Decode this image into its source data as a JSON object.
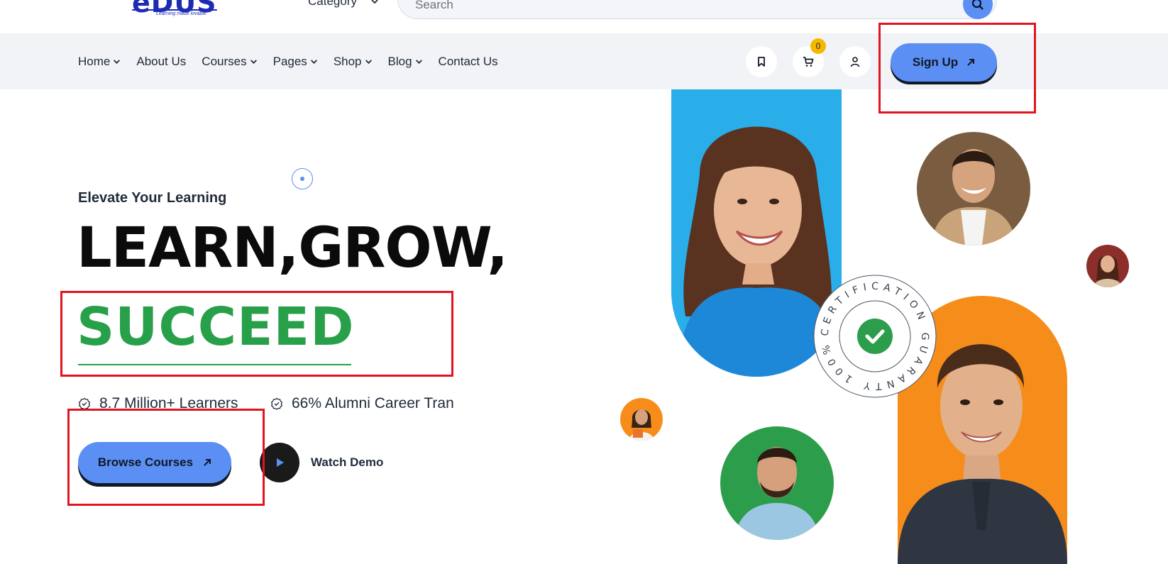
{
  "header": {
    "logo_text": "eDUS",
    "logo_tagline": "Learning made lovable",
    "category_label": "Category",
    "search_placeholder": "Search"
  },
  "nav": {
    "items": [
      {
        "label": "Home",
        "has_dropdown": true
      },
      {
        "label": "About Us",
        "has_dropdown": false
      },
      {
        "label": "Courses",
        "has_dropdown": true
      },
      {
        "label": "Pages",
        "has_dropdown": true
      },
      {
        "label": "Shop",
        "has_dropdown": true
      },
      {
        "label": "Blog",
        "has_dropdown": true
      },
      {
        "label": "Contact Us",
        "has_dropdown": false
      }
    ],
    "cart_count": "0",
    "signup_label": "Sign Up"
  },
  "hero": {
    "eyebrow": "Elevate Your Learning",
    "headline": "LEARN,GROW,",
    "highlight": "SUCCEED",
    "stats": [
      {
        "text": "8.7 Million+ Learners"
      },
      {
        "text": "66% Alumni Career Tran"
      }
    ],
    "browse_label": "Browse Courses",
    "watch_label": "Watch Demo"
  },
  "badge": {
    "ring_text": "CERTIFICATION GUARANTY 100%"
  },
  "colors": {
    "accent_blue": "#5b8ff3",
    "success_green": "#28a04a",
    "badge_yellow": "#f5b800",
    "photo_blue": "#29aee9",
    "photo_orange": "#f68d1b",
    "photo_green": "#2c9d4a",
    "photo_brown": "#7a5c40",
    "photo_maroon": "#8c2f2a",
    "annotation_red": "#e0161e"
  }
}
